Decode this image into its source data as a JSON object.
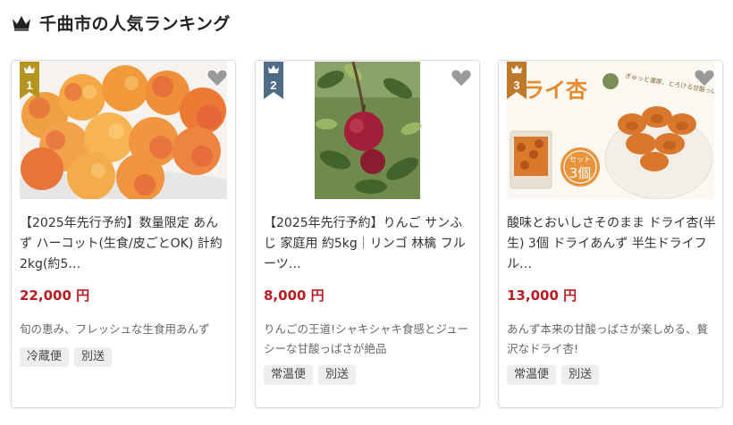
{
  "header": {
    "title": "千曲市の人気ランキング",
    "icon": "crown-icon"
  },
  "colors": {
    "price": "#b81c22",
    "rank1": "#b3951f",
    "rank2": "#4f6b86",
    "rank3": "#c0792a"
  },
  "products": [
    {
      "rank": "1",
      "title": "【2025年先行予約】数量限定 あんず ハーコット(生食/皮ごとOK) 計約2kg(約5…",
      "price": "22,000 円",
      "description": "旬の恵み、フレッシュな生食用あんず",
      "tags": [
        "冷蔵便",
        "別送"
      ]
    },
    {
      "rank": "2",
      "title": "【2025年先行予約】りんご サンふじ 家庭用 約5kg｜リンゴ 林檎 フルーツ…",
      "price": "8,000 円",
      "description": "りんごの王道!シャキシャキ食感とジューシーな甘酸っぱさが絶品",
      "tags": [
        "常温便",
        "別送"
      ]
    },
    {
      "rank": "3",
      "title": "酸味とおいしさそのまま ドライ杏(半生) 3個 ドライあんず 半生ドライフル…",
      "price": "13,000 円",
      "description": "あんず本来の甘酸っぱさが楽しめる、贅沢なドライ杏!",
      "tags": [
        "常温便",
        "別送"
      ],
      "image_text": {
        "main": "ライ杏",
        "side": "ぎゅっと濃厚、とろける甘酸っぱさ",
        "badge_top": "3個",
        "badge_small": "セット"
      }
    }
  ]
}
